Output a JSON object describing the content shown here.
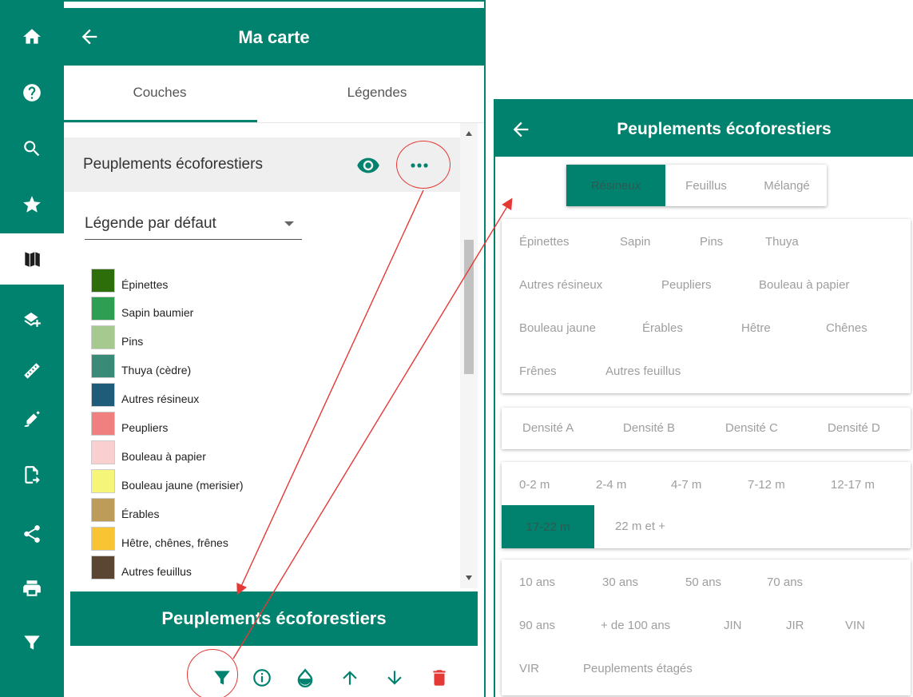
{
  "colors": {
    "accent": "#00826e",
    "annotation": "#e53935",
    "delete": "#e53935"
  },
  "rail": {
    "items": [
      {
        "icon": "home-icon",
        "active": false
      },
      {
        "icon": "help-icon",
        "active": false
      },
      {
        "icon": "search-icon",
        "active": false
      },
      {
        "icon": "star-icon",
        "active": false
      },
      {
        "icon": "map-icon",
        "active": true
      },
      {
        "icon": "add-layer-icon",
        "active": false
      },
      {
        "icon": "ruler-icon",
        "active": false
      },
      {
        "icon": "draw-icon",
        "active": false
      },
      {
        "icon": "import-file-icon",
        "active": false
      },
      {
        "icon": "share-icon",
        "active": false
      },
      {
        "icon": "print-icon",
        "active": false
      },
      {
        "icon": "filter-icon",
        "active": false
      }
    ]
  },
  "panel": {
    "title": "Ma carte",
    "tabs": [
      "Couches",
      "Légendes"
    ],
    "active_tab": "Couches",
    "layer_name": "Peuplements écoforestiers",
    "legend_select": "Légende par défaut",
    "legend_items": [
      {
        "label": "Épinettes",
        "color": "#2d6e0a"
      },
      {
        "label": "Sapin baumier",
        "color": "#2e9e52"
      },
      {
        "label": "Pins",
        "color": "#a5c98f"
      },
      {
        "label": "Thuya (cèdre)",
        "color": "#3a8a78"
      },
      {
        "label": "Autres résineux",
        "color": "#1f5c7a"
      },
      {
        "label": "Peupliers",
        "color": "#f07f7f"
      },
      {
        "label": "Bouleau à papier",
        "color": "#f9cfcf"
      },
      {
        "label": "Bouleau jaune (merisier)",
        "color": "#f5f57a"
      },
      {
        "label": "Érables",
        "color": "#bc9c58"
      },
      {
        "label": "Hêtre, chênes, frênes",
        "color": "#f9c434"
      },
      {
        "label": "Autres feuillus",
        "color": "#5a4632"
      }
    ],
    "banner": "Peuplements écoforestiers",
    "toolbar": [
      "filter-icon",
      "info-icon",
      "opacity-icon",
      "arrow-up-icon",
      "arrow-down-icon",
      "delete-icon"
    ]
  },
  "filter_panel": {
    "title": "Peuplements écoforestiers",
    "species_groups": [
      "Résineux",
      "Feuillus",
      "Mélangé"
    ],
    "species_selected": "Résineux",
    "species": [
      [
        "Épinettes",
        "Sapin",
        "Pins",
        "Thuya"
      ],
      [
        "Autres résineux",
        "Peupliers",
        "Bouleau à papier"
      ],
      [
        "Bouleau jaune",
        "Érables",
        "Hêtre",
        "Chênes"
      ],
      [
        "Frênes",
        "Autres feuillus"
      ]
    ],
    "density": [
      "Densité A",
      "Densité B",
      "Densité C",
      "Densité D"
    ],
    "height": [
      [
        "0-2 m",
        "2-4 m",
        "4-7 m",
        "7-12 m",
        "12-17 m"
      ],
      [
        "17-22 m",
        "22 m et +"
      ]
    ],
    "height_selected": "17-22 m",
    "age": [
      [
        "10 ans",
        "30 ans",
        "50 ans",
        "70 ans"
      ],
      [
        "90 ans",
        "+ de 100 ans",
        "JIN",
        "JIR",
        "VIN"
      ],
      [
        "VIR",
        "Peuplements étagés"
      ]
    ]
  }
}
